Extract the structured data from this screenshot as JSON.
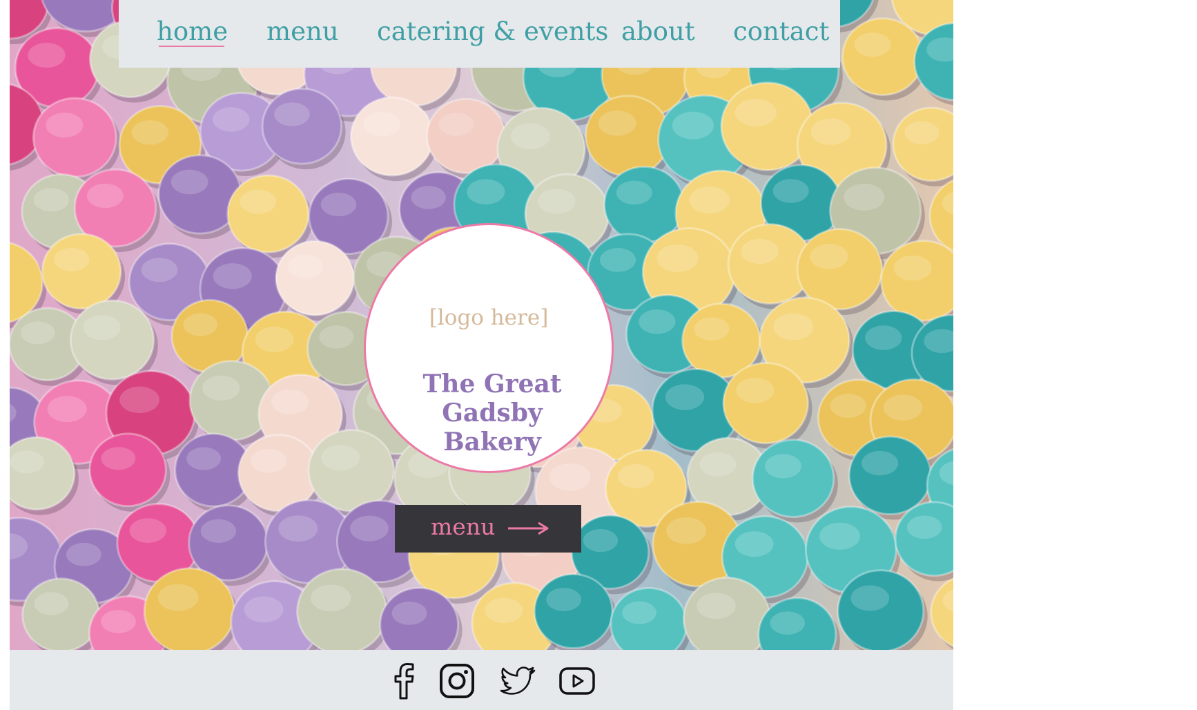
{
  "nav": {
    "items": [
      {
        "label": "home",
        "active": true
      },
      {
        "label": "menu",
        "active": false
      },
      {
        "label": "catering & events",
        "active": false
      },
      {
        "label": "about",
        "active": false
      },
      {
        "label": "contact",
        "active": false
      }
    ]
  },
  "hero": {
    "logo_placeholder": "[logo here]",
    "brand_name_line1": "The Great Gadsby",
    "brand_name_line2": "Bakery",
    "cta_label": "menu"
  },
  "footer": {
    "social_icons": [
      "facebook-icon",
      "instagram-icon",
      "twitter-icon",
      "youtube-icon"
    ]
  },
  "colors": {
    "nav_text": "#3f9fa4",
    "accent_pink": "#ec7aa6",
    "brand_purple": "#8f73b4",
    "logo_tan": "#d4b99a",
    "button_dark": "#35353a",
    "bar_grey": "#e5e9ec"
  }
}
